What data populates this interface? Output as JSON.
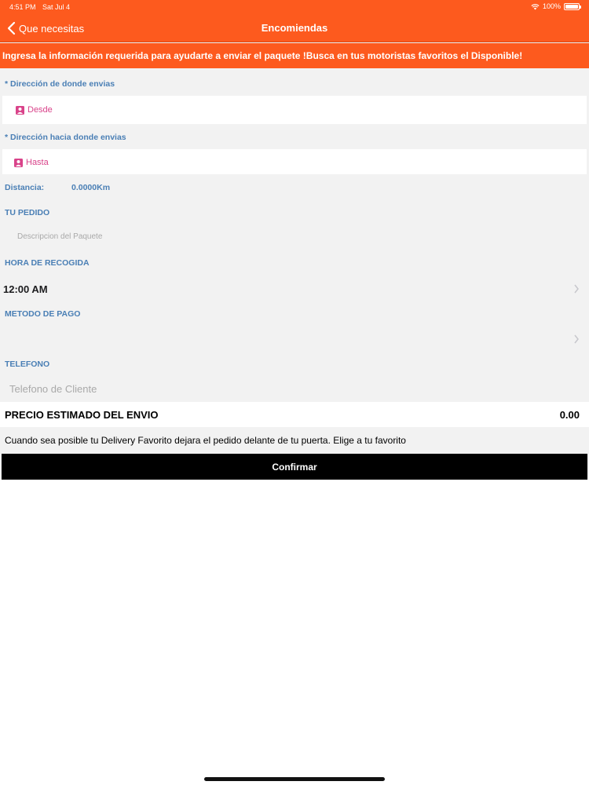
{
  "status_bar": {
    "time": "4:51 PM",
    "date": "Sat Jul 4",
    "battery": "100%"
  },
  "nav": {
    "back_label": "Que necesitas",
    "title": "Encomiendas"
  },
  "banner": {
    "text": "Ingresa la información requerida para ayudarte a enviar el paquete !Busca en tus motoristas favoritos el Disponible!"
  },
  "origin": {
    "label": "* Dirección de donde envias",
    "placeholder": "Desde"
  },
  "destination": {
    "label": "* Dirección hacia donde envias",
    "placeholder": "Hasta"
  },
  "distance": {
    "label": "Distancia:",
    "value": "0.0000Km"
  },
  "order": {
    "label": "TU PEDIDO",
    "placeholder": "Descripcion del Paquete"
  },
  "pickup": {
    "label": "HORA DE RECOGIDA",
    "value": "12:00 AM"
  },
  "payment": {
    "label": "METODO DE PAGO",
    "value": ""
  },
  "phone": {
    "label": "TELEFONO",
    "placeholder": "Telefono de Cliente"
  },
  "price": {
    "label": "PRECIO ESTIMADO DEL ENVIO",
    "value": "0.00"
  },
  "info": {
    "text": "Cuando sea posible tu Delivery Favorito dejara el pedido delante de tu puerta. Elige a tu favorito"
  },
  "confirm": {
    "label": "Confirmar"
  },
  "colors": {
    "header": "#fd5a1e",
    "label_blue": "#4a7fb5",
    "accent_pink": "#d9438a"
  }
}
